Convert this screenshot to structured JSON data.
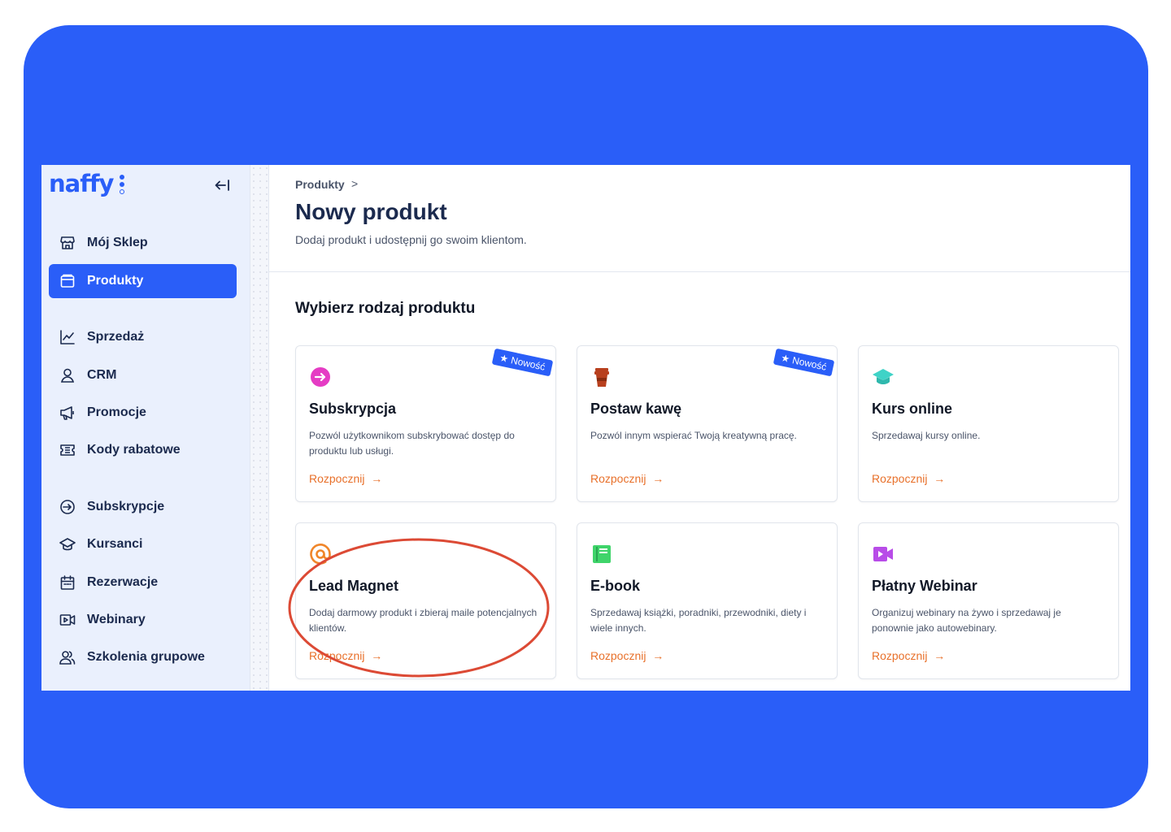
{
  "app": {
    "logo_text": "naffy",
    "brand_color": "#2a5ef8",
    "accent_color": "#e8702a",
    "annotation_color": "#dc4a35"
  },
  "sidebar": {
    "items": [
      {
        "label": "Mój Sklep",
        "icon": "store-icon"
      },
      {
        "label": "Produkty",
        "icon": "folder-icon",
        "active": true
      },
      {
        "label": "Sprzedaż",
        "icon": "chart-line-icon"
      },
      {
        "label": "CRM",
        "icon": "user-icon"
      },
      {
        "label": "Promocje",
        "icon": "megaphone-icon"
      },
      {
        "label": "Kody rabatowe",
        "icon": "ticket-icon"
      },
      {
        "label": "Subskrypcje",
        "icon": "subscription-icon"
      },
      {
        "label": "Kursanci",
        "icon": "graduation-cap-icon"
      },
      {
        "label": "Rezerwacje",
        "icon": "calendar-icon"
      },
      {
        "label": "Webinary",
        "icon": "video-icon"
      },
      {
        "label": "Szkolenia grupowe",
        "icon": "users-icon"
      }
    ]
  },
  "header": {
    "breadcrumb": "Produkty",
    "breadcrumb_sep": ">",
    "title": "Nowy produkt",
    "subtitle": "Dodaj produkt i udostępnij go swoim klientom."
  },
  "section": {
    "title": "Wybierz rodzaj produktu"
  },
  "cards": [
    {
      "title": "Subskrypcja",
      "desc": "Pozwól użytkownikom subskrybować dostęp do produktu lub usługi.",
      "start": "Rozpocznij",
      "badge": "Nowość",
      "icon": "subscription-arrow-icon",
      "icon_color": "#e53cc4"
    },
    {
      "title": "Postaw kawę",
      "desc": "Pozwól innym wspierać Twoją kreatywną pracę.",
      "start": "Rozpocznij",
      "badge": "Nowość",
      "icon": "coffee-cup-icon",
      "icon_color": "#b8401e"
    },
    {
      "title": "Kurs online",
      "desc": "Sprzedawaj kursy online.",
      "start": "Rozpocznij",
      "icon": "graduation-cap-icon",
      "icon_color": "#3fd3c7"
    },
    {
      "title": "Lead Magnet",
      "desc": "Dodaj darmowy produkt i zbieraj maile potencjalnych klientów.",
      "start": "Rozpocznij",
      "icon": "at-sign-icon",
      "icon_color": "#f0862a"
    },
    {
      "title": "E-book",
      "desc": "Sprzedawaj książki, poradniki, przewodniki, diety i wiele innych.",
      "start": "Rozpocznij",
      "icon": "book-icon",
      "icon_color": "#3fd46a"
    },
    {
      "title": "Płatny Webinar",
      "desc": "Organizuj webinary na żywo i sprzedawaj je ponownie jako autowebinary.",
      "start": "Rozpocznij",
      "icon": "video-camera-icon",
      "icon_color": "#b84ce8"
    }
  ],
  "arrow": "→",
  "badge_star": "★"
}
